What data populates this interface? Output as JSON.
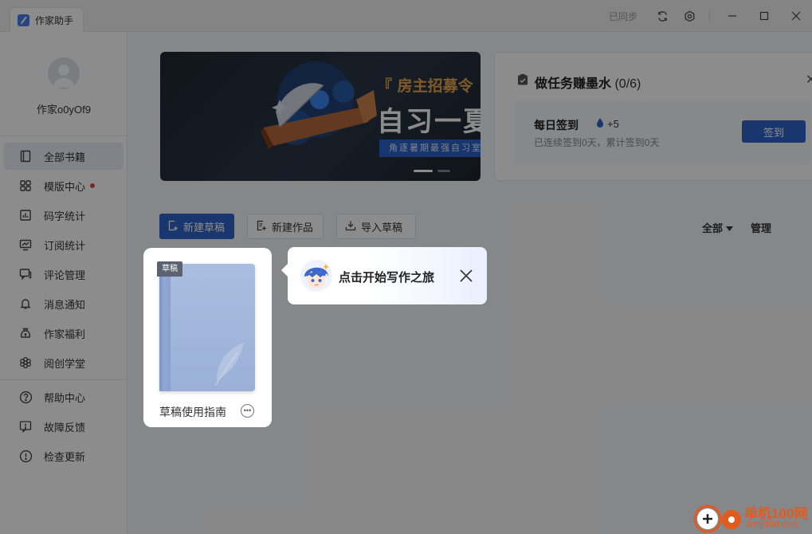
{
  "app": {
    "title": "作家助手"
  },
  "titlebar": {
    "sync_status": "已同步"
  },
  "sidebar": {
    "username": "作家o0yOf9",
    "items": [
      {
        "label": "全部书籍",
        "icon": "book-icon",
        "active": true
      },
      {
        "label": "模版中心",
        "icon": "grid-icon",
        "badge": "red-dot"
      },
      {
        "label": "码字统计",
        "icon": "bar-chart-icon"
      },
      {
        "label": "订阅统计",
        "icon": "line-chart-icon"
      },
      {
        "label": "评论管理",
        "icon": "comment-icon"
      },
      {
        "label": "消息通知",
        "icon": "bell-icon"
      },
      {
        "label": "作家福利",
        "icon": "gift-bag-icon"
      },
      {
        "label": "阅创学堂",
        "icon": "flower-icon"
      }
    ],
    "bottom_items": [
      {
        "label": "帮助中心",
        "icon": "help-icon"
      },
      {
        "label": "故障反馈",
        "icon": "feedback-icon"
      },
      {
        "label": "检查更新",
        "icon": "update-icon"
      }
    ]
  },
  "banner": {
    "line1": "『 房主招募令",
    "line2": "自习一夏",
    "line3": "角逐暑期最强自习室"
  },
  "tasks": {
    "title": "做任务赚墨水",
    "progress": "(0/6)",
    "checkin_title": "每日签到",
    "reward": "+5",
    "checkin_sub": "已连续签到0天，累计签到0天",
    "checkin_button": "签到"
  },
  "toolbar": {
    "new_draft": "新建草稿",
    "new_work": "新建作品",
    "import_draft": "导入草稿",
    "filter": "全部",
    "manage": "管理"
  },
  "book": {
    "tag": "草稿",
    "title": "草稿使用指南"
  },
  "tooltip": {
    "text": "点击开始写作之旅"
  },
  "watermark": {
    "text": "单机100网",
    "url": "danji100.com"
  },
  "colors": {
    "accent": "#2f64c9",
    "badge_red": "#e8453c",
    "banner_gold": "#e8a74f"
  }
}
